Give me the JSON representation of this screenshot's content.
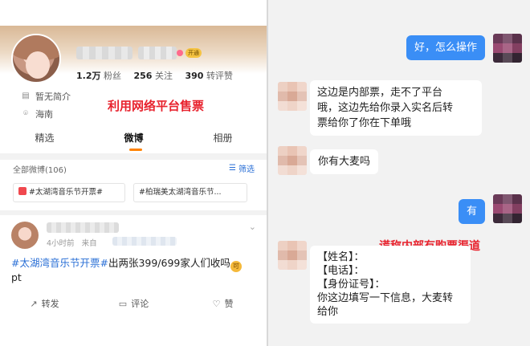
{
  "left": {
    "vip_badge": "开通",
    "stats": [
      {
        "num": "1.2万",
        "label": "粉丝"
      },
      {
        "num": "256",
        "label": "关注"
      },
      {
        "num": "390",
        "label": "转评赞"
      }
    ],
    "intro": "暂无简介",
    "location": "海南",
    "annotation": "利用网络平台售票",
    "tabs": [
      "精选",
      "微博",
      "相册"
    ],
    "active_tab": "微博",
    "all_weibo": "全部微博(106)",
    "filter": "筛选",
    "topics": [
      "#太湖湾音乐节开票#",
      "#柏瑞美太湖湾音乐节..."
    ],
    "post": {
      "time": "4小时前",
      "source_prefix": "来自",
      "tag": "#太湖湾音乐节开票#",
      "text_after_tag": "出两张399/699家人们收吗",
      "emoji": "可",
      "text_line2": "pt"
    },
    "actions": [
      {
        "icon": "share-icon",
        "label": "转发"
      },
      {
        "icon": "comment-icon",
        "label": "评论"
      },
      {
        "icon": "like-icon",
        "label": "赞"
      }
    ]
  },
  "right": {
    "messages": [
      {
        "from": "me",
        "text": "好，怎么操作"
      },
      {
        "from": "them",
        "lines": [
          "这边是内部票，走不了平台",
          "哦，这边先给你录入实名后转",
          "票给你了你在下单哦"
        ]
      },
      {
        "from": "them",
        "text": "你有大麦吗"
      },
      {
        "from": "me",
        "text": "有"
      },
      {
        "from": "them",
        "lines": [
          "【姓名】：",
          "【电话】：",
          "【身份证号】：",
          "你这边填写一下信息，大麦转",
          "给你"
        ]
      }
    ],
    "annotation": "谎称内部有购票渠道"
  }
}
